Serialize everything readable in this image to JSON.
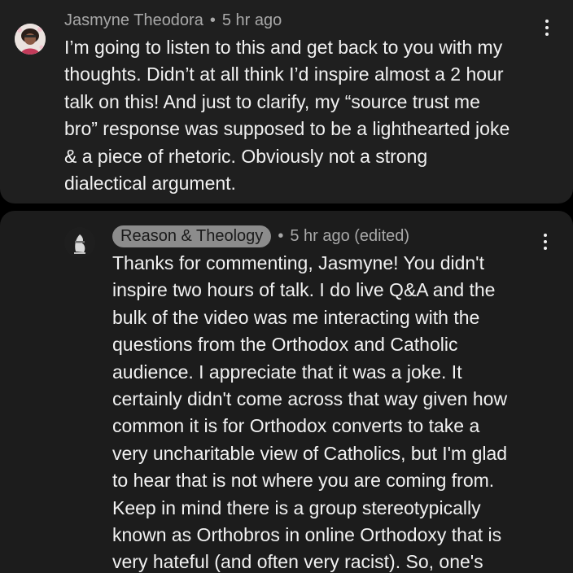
{
  "colors": {
    "background": "#000000",
    "card": "#1f1f1f",
    "primary_text": "#f1f1f1",
    "secondary_text": "#a8a8a8",
    "author_badge": "#8c8c8c"
  },
  "comment": {
    "author": "Jasmyne Theodora",
    "separator": "•",
    "time": "5 hr ago",
    "avatar_icon": "profile-photo-icon",
    "menu_icon": "more-vertical-icon",
    "lines": [
      "I’m going to listen to this and get back to you with my",
      "thoughts. Didn’t at all think I’d inspire almost a 2 hour",
      "talk on this! And just to clarify, my “source trust me",
      "bro” response was supposed to be a lighthearted joke",
      "& a piece of rhetoric. Obviously not a strong",
      "dialectical argument."
    ]
  },
  "reply": {
    "author": "Reason & Theology",
    "separator": "•",
    "time": "5 hr ago (edited)",
    "avatar_icon": "channel-logo-icon",
    "menu_icon": "more-vertical-icon",
    "lines": [
      "Thanks for commenting, Jasmyne! You didn't",
      "inspire two hours of talk. I do live Q&A and the",
      "bulk of the video was me interacting with the",
      "questions from the Orthodox and Catholic",
      "audience. I appreciate that it was a joke. It",
      "certainly didn't come across that way given how",
      "common it is for Orthodox converts to take a",
      "very uncharitable view of Catholics, but I'm glad",
      "to hear that is not where you are coming from.",
      "Keep in mind there is a group stereotypically",
      "known as Orthobros in online Orthodoxy that is",
      "very hateful (and often very racist). So, one's"
    ]
  }
}
